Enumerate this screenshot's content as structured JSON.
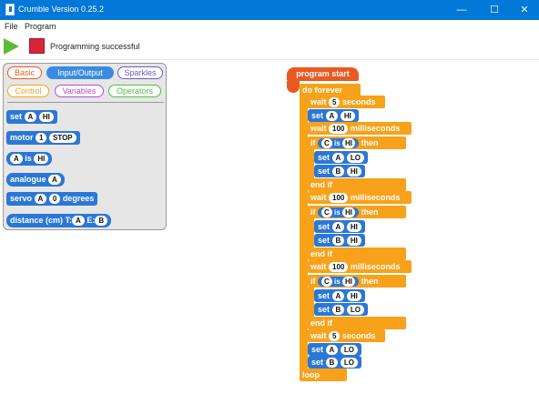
{
  "window": {
    "title": "Crumble Version 0.25.2"
  },
  "controls": {
    "minimize": "—",
    "maximize": "☐",
    "close": "✕"
  },
  "menu": {
    "file": "File",
    "program": "Program"
  },
  "toolbar": {
    "status": "Programming successful"
  },
  "palette": {
    "categories": [
      "Basic",
      "Input/Output",
      "Sparkles",
      "Control",
      "Variables",
      "Operators"
    ],
    "blocks": {
      "set": [
        "set",
        "A",
        "HI"
      ],
      "motor": [
        "motor",
        "1",
        "STOP"
      ],
      "is": [
        "A",
        "is",
        "HI"
      ],
      "analogue": [
        "analogue",
        "A"
      ],
      "servo": [
        "servo",
        "A",
        "0",
        "degrees"
      ],
      "distance": [
        "distance (cm)",
        "T:",
        "A",
        "E:",
        "B"
      ]
    }
  },
  "program": {
    "start": "program start",
    "do_forever": "do forever",
    "loop": "loop",
    "wait1": [
      "wait",
      "5",
      "seconds"
    ],
    "set1": [
      "set",
      "A",
      "HI"
    ],
    "wait2": [
      "wait",
      "100",
      "milliseconds"
    ],
    "if1": [
      "if",
      "C",
      "is",
      "HI",
      "then"
    ],
    "if1_body": [
      [
        "set",
        "A",
        "LO"
      ],
      [
        "set",
        "B",
        "HI"
      ]
    ],
    "end_if": "end if",
    "wait3": [
      "wait",
      "100",
      "milliseconds"
    ],
    "if2": [
      "if",
      "C",
      "is",
      "HI",
      "then"
    ],
    "if2_body": [
      [
        "set",
        "A",
        "HI"
      ],
      [
        "set",
        "B",
        "HI"
      ]
    ],
    "wait4": [
      "wait",
      "100",
      "milliseconds"
    ],
    "if3": [
      "if",
      "C",
      "is",
      "HI",
      "then"
    ],
    "if3_body": [
      [
        "set",
        "A",
        "HI"
      ],
      [
        "set",
        "B",
        "LO"
      ]
    ],
    "wait5": [
      "wait",
      "5",
      "seconds"
    ],
    "set_last": [
      [
        "set",
        "A",
        "LO"
      ],
      [
        "set",
        "B",
        "LO"
      ]
    ]
  },
  "colors": {
    "titlebar": "#0078d7",
    "cat_basic": "#e85a22",
    "cat_sparkles": "#6a5acd",
    "cat_control": "#f7a21a",
    "cat_variables": "#b34fd1",
    "cat_operators": "#4fbf3f",
    "block_blue": "#2b77d6",
    "block_orange": "#f7a21a",
    "hat": "#e85a22"
  }
}
